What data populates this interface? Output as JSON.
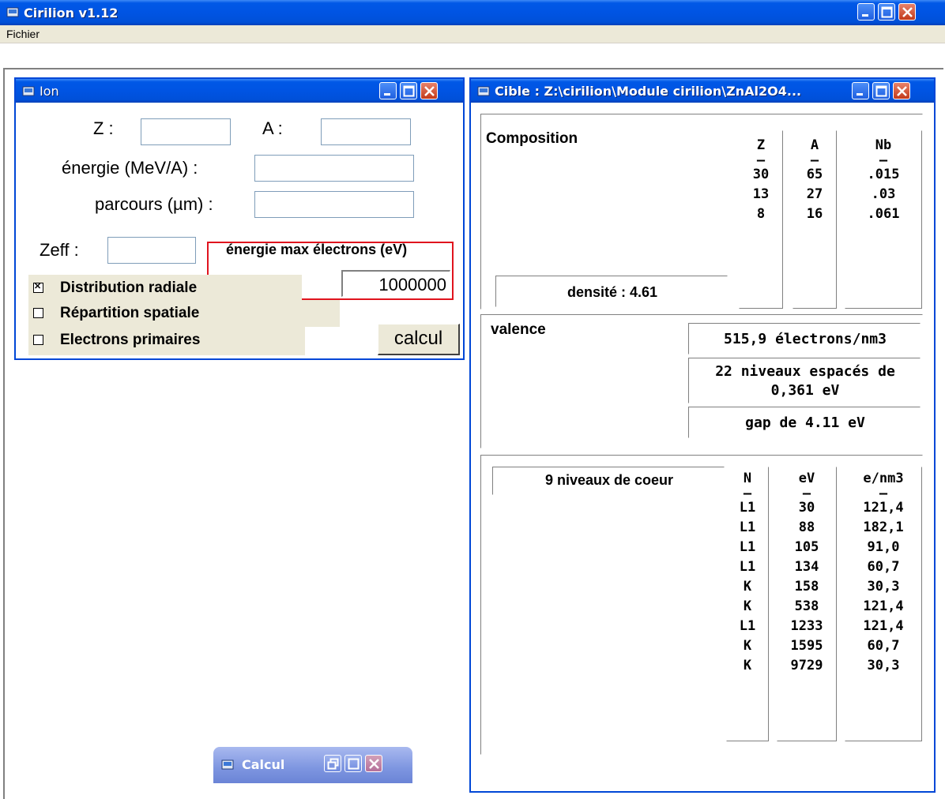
{
  "app": {
    "title": "Cirilion v1.12",
    "menu": [
      "Fichier"
    ]
  },
  "ion_window": {
    "title": "Ion",
    "z_label": "Z :",
    "a_label": "A :",
    "energy_label": "énergie (MeV/A) :",
    "range_label": "parcours (µm) :",
    "zeff_label": "Zeff :",
    "emax_label": "énergie max électrons (eV)",
    "emax_value": "1000000",
    "checkboxes": [
      {
        "label": "Distribution radiale",
        "checked": true
      },
      {
        "label": "Répartition spatiale",
        "checked": false
      },
      {
        "label": "Electrons primaires",
        "checked": false
      }
    ],
    "check_mark": "✕",
    "calc_button": "calcul"
  },
  "cible_window": {
    "title": "Cible : Z:\\cirilion\\Module cirilion\\ZnAl2O4...",
    "composition": {
      "label": "Composition",
      "columns": [
        {
          "header": "Z",
          "values": [
            "30",
            "13",
            "8"
          ]
        },
        {
          "header": "A",
          "values": [
            "65",
            "27",
            "16"
          ]
        },
        {
          "header": "Nb",
          "values": [
            ".015",
            ".03",
            ".061"
          ]
        }
      ],
      "dash": "—",
      "density": "densité : 4.61"
    },
    "valence": {
      "label": "valence",
      "electrons": "515,9 électrons/nm3",
      "levels_line1": "22 niveaux espacés de",
      "levels_line2": "0,361 eV",
      "gap": "gap de  4.11 eV"
    },
    "core": {
      "label": "9 niveaux de coeur",
      "columns": [
        {
          "header": "N",
          "values": [
            "L1",
            "L1",
            "L1",
            "L1",
            "K",
            "K",
            "L1",
            "K",
            "K"
          ]
        },
        {
          "header": "eV",
          "values": [
            "30",
            "88",
            "105",
            "134",
            "158",
            "538",
            "1233",
            "1595",
            "9729"
          ]
        },
        {
          "header": "e/nm3",
          "values": [
            "121,4",
            "182,1",
            "91,0",
            "60,7",
            "30,3",
            "121,4",
            "121,4",
            "60,7",
            "30,3"
          ]
        }
      ]
    }
  },
  "calcul_window": {
    "title": "Calcul"
  },
  "colors": {
    "xp_blue": "#0054e3",
    "highlight_red": "#e0141e",
    "button_face": "#ece9d8"
  },
  "icons": [
    "app-icon",
    "minimize-icon",
    "maximize-icon",
    "close-icon",
    "restore-icon",
    "checkbox-check-icon"
  ]
}
